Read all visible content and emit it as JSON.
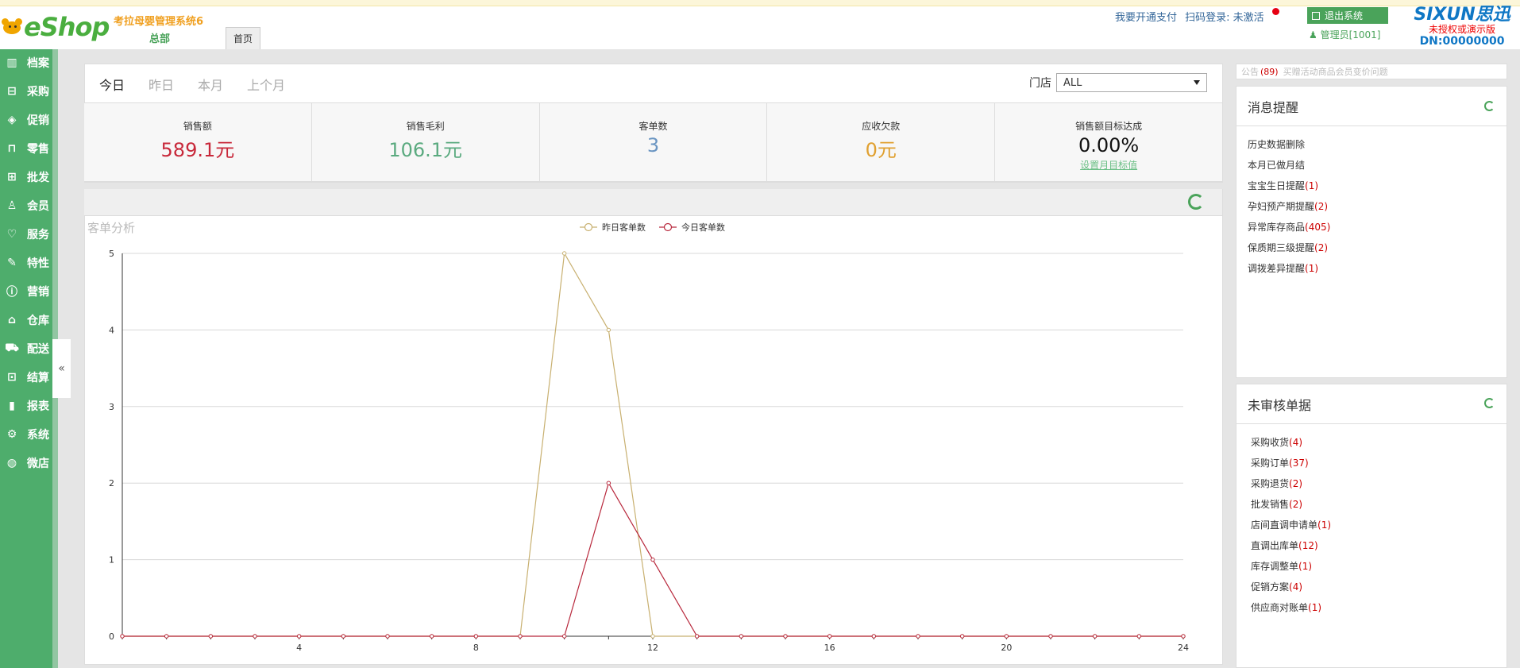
{
  "header": {
    "app_name": "考拉母婴管理系统6",
    "branch": "总部",
    "tab_home": "首页",
    "links": [
      "我要开通支付",
      "扫码登录: 未激活"
    ],
    "logout": "退出系统",
    "admin": "管理员[1001]",
    "brand": "SIXUN思迅",
    "unauthorized": "未授权或演示版",
    "dn": "DN:00000000",
    "logo_text": "eShop"
  },
  "sidebar": {
    "items": [
      {
        "label": "档案",
        "icon": "archive-icon"
      },
      {
        "label": "采购",
        "icon": "basket-icon"
      },
      {
        "label": "促销",
        "icon": "tag-icon"
      },
      {
        "label": "零售",
        "icon": "bag-icon"
      },
      {
        "label": "批发",
        "icon": "box-icon"
      },
      {
        "label": "会员",
        "icon": "user-icon"
      },
      {
        "label": "服务",
        "icon": "heart-icon"
      },
      {
        "label": "特性",
        "icon": "wand-icon"
      },
      {
        "label": "营销",
        "icon": "info-icon"
      },
      {
        "label": "仓库",
        "icon": "warehouse-icon"
      },
      {
        "label": "配送",
        "icon": "truck-icon"
      },
      {
        "label": "结算",
        "icon": "settle-icon"
      },
      {
        "label": "报表",
        "icon": "bar-chart-icon"
      },
      {
        "label": "系统",
        "icon": "gear-icon"
      },
      {
        "label": "微店",
        "icon": "shop-icon"
      }
    ],
    "collapse": "«"
  },
  "period_tabs": [
    "今日",
    "昨日",
    "本月",
    "上个月"
  ],
  "store": {
    "label": "门店",
    "value": "ALL"
  },
  "stats": [
    {
      "label": "销售额",
      "value": "589.1元",
      "color": "#c8283a"
    },
    {
      "label": "销售毛利",
      "value": "106.1元",
      "color": "#5aaa7f"
    },
    {
      "label": "客单数",
      "value": "3",
      "color": "#6a95c2"
    },
    {
      "label": "应收欠款",
      "value": "0元",
      "color": "#e0a030"
    },
    {
      "label": "销售额目标达成",
      "value": "0.00%",
      "color": "#111111",
      "link": "设置月目标值"
    }
  ],
  "notice": {
    "label": "公告",
    "count": "(89)",
    "text": "买赠活动商品会员变价问题"
  },
  "messages": {
    "title": "消息提醒",
    "items": [
      {
        "text": "历史数据删除",
        "count": ""
      },
      {
        "text": "本月已做月结",
        "count": ""
      },
      {
        "text": "宝宝生日提醒",
        "count": "(1)"
      },
      {
        "text": "孕妇预产期提醒",
        "count": "(2)"
      },
      {
        "text": "异常库存商品",
        "count": "(405)"
      },
      {
        "text": "保质期三级提醒",
        "count": "(2)"
      },
      {
        "text": "调拨差异提醒",
        "count": "(1)"
      }
    ]
  },
  "unreviewed": {
    "title": "未审核单据",
    "items": [
      {
        "text": "采购收货",
        "count": "(4)"
      },
      {
        "text": "采购订单",
        "count": "(37)"
      },
      {
        "text": "采购退货",
        "count": "(2)"
      },
      {
        "text": "批发销售",
        "count": "(2)"
      },
      {
        "text": "店间直调申请单",
        "count": "(1)"
      },
      {
        "text": "直调出库单",
        "count": "(12)"
      },
      {
        "text": "库存调整单",
        "count": "(1)"
      },
      {
        "text": "促销方案",
        "count": "(4)"
      },
      {
        "text": "供应商对账单",
        "count": "(1)"
      }
    ]
  },
  "chart_data": {
    "type": "line",
    "title": "客单分析",
    "x": [
      0,
      1,
      2,
      3,
      4,
      5,
      6,
      7,
      8,
      9,
      10,
      11,
      12,
      13,
      14,
      15,
      16,
      17,
      18,
      19,
      20,
      21,
      22,
      23,
      24
    ],
    "x_tick_labels": [
      "4",
      "8",
      "12",
      "16",
      "20",
      "24"
    ],
    "y_tick_labels": [
      "0",
      "1",
      "2",
      "3",
      "4",
      "5"
    ],
    "ylim": [
      0,
      5
    ],
    "xlim": [
      0,
      24
    ],
    "legend_position": "top-center",
    "grid": true,
    "series": [
      {
        "name": "昨日客单数",
        "color": "#c8b070",
        "values": [
          0,
          0,
          0,
          0,
          0,
          0,
          0,
          0,
          0,
          0,
          5,
          4,
          0,
          0,
          0,
          0,
          0,
          0,
          0,
          0,
          0,
          0,
          0,
          0,
          0
        ]
      },
      {
        "name": "今日客单数",
        "color": "#b8283c",
        "values": [
          0,
          0,
          0,
          0,
          0,
          0,
          0,
          0,
          0,
          0,
          0,
          2,
          1,
          0,
          0,
          0,
          0,
          0,
          0,
          0,
          0,
          0,
          0,
          0,
          0
        ]
      }
    ]
  }
}
